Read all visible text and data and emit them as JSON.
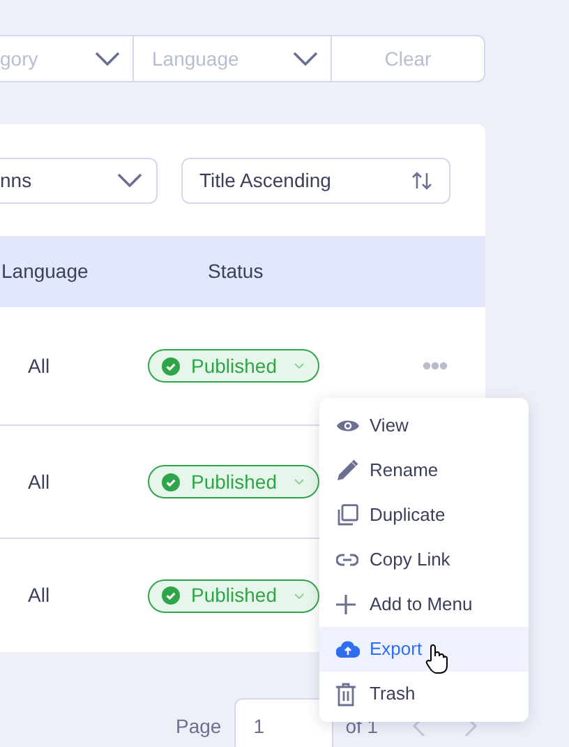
{
  "filters": {
    "category_placeholder": "gory",
    "language_placeholder": "Language",
    "clear": "Clear"
  },
  "toolbar": {
    "columns_value": "nns",
    "sort_value": "Title Ascending"
  },
  "table": {
    "columns": [
      "Language",
      "Status"
    ],
    "rows": [
      {
        "language": "All",
        "status": "Published"
      },
      {
        "language": "All",
        "status": "Published"
      },
      {
        "language": "All",
        "status": "Published"
      }
    ]
  },
  "menu": {
    "items": [
      {
        "label": "View",
        "selected": false
      },
      {
        "label": "Rename",
        "selected": false
      },
      {
        "label": "Duplicate",
        "selected": false
      },
      {
        "label": "Copy Link",
        "selected": false
      },
      {
        "label": "Add to Menu",
        "selected": false
      },
      {
        "label": "Export",
        "selected": true
      },
      {
        "label": "Trash",
        "selected": false
      }
    ]
  },
  "pagination": {
    "label": "Page",
    "value": "1",
    "of": "of 1"
  }
}
